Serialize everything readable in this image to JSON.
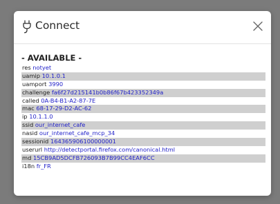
{
  "dialog": {
    "title": "Connect",
    "close_icon": "close-x-icon",
    "plug_icon": "plug-icon"
  },
  "content": {
    "heading": "- AVAILABLE -",
    "rows": [
      {
        "key": "res",
        "value": "notyet",
        "shaded": false
      },
      {
        "key": "uamip",
        "value": "10.1.0.1",
        "shaded": true
      },
      {
        "key": "uamport",
        "value": "3990",
        "shaded": false
      },
      {
        "key": "challenge",
        "value": "fa6f27d215141b0b86f67b423352349a",
        "shaded": true
      },
      {
        "key": "called",
        "value": "0A-B4-B1-A2-87-7E",
        "shaded": false
      },
      {
        "key": "mac",
        "value": "68-17-29-D2-AC-62",
        "shaded": true
      },
      {
        "key": "ip",
        "value": "10.1.1.0",
        "shaded": false
      },
      {
        "key": "ssid",
        "value": "our_internet_cafe",
        "shaded": true
      },
      {
        "key": "nasid",
        "value": "our_internet_cafe_mcp_34",
        "shaded": false
      },
      {
        "key": "sessionid",
        "value": "164365906100000001",
        "shaded": true
      },
      {
        "key": "userurl",
        "value": "http://detectportal.firefox.com/canonical.html",
        "shaded": false
      },
      {
        "key": "md",
        "value": "15CB9AD5DCFB726093B7B99CC4EAF6CC",
        "shaded": true
      },
      {
        "key": "i18n",
        "value": "fr_FR",
        "shaded": false
      }
    ]
  },
  "colors": {
    "overlay": "#7b7b7b",
    "value_text": "#1e1ec8",
    "row_shade": "#cfcfcf"
  }
}
